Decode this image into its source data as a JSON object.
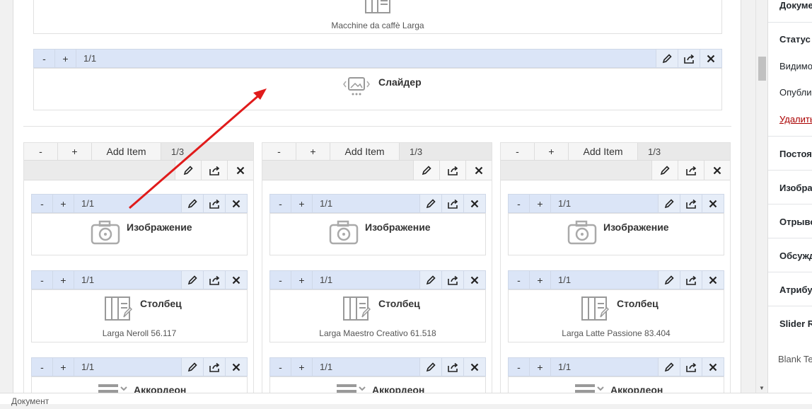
{
  "top_element": {
    "subtitle": "Macchine da caffè Larga"
  },
  "slider_element": {
    "counter": "1/1",
    "title": "Слайдер"
  },
  "columns": [
    {
      "head": {
        "minus": "-",
        "plus": "+",
        "add_item": "Add Item",
        "ratio": "1/3"
      },
      "elements": [
        {
          "counter": "1/1",
          "title": "Изображение",
          "subtitle": ""
        },
        {
          "counter": "1/1",
          "title": "Столбец",
          "subtitle": "Larga Neroll 56.117"
        },
        {
          "counter": "1/1",
          "title": "Аккордеон",
          "subtitle": ""
        }
      ]
    },
    {
      "head": {
        "minus": "-",
        "plus": "+",
        "add_item": "Add Item",
        "ratio": "1/3"
      },
      "elements": [
        {
          "counter": "1/1",
          "title": "Изображение",
          "subtitle": ""
        },
        {
          "counter": "1/1",
          "title": "Столбец",
          "subtitle": "Larga Maestro Creativo 61.518"
        },
        {
          "counter": "1/1",
          "title": "Аккордеон",
          "subtitle": ""
        }
      ]
    },
    {
      "head": {
        "minus": "-",
        "plus": "+",
        "add_item": "Add Item",
        "ratio": "1/3"
      },
      "elements": [
        {
          "counter": "1/1",
          "title": "Изображение",
          "subtitle": ""
        },
        {
          "counter": "1/1",
          "title": "Столбец",
          "subtitle": "Larga Latte Passione 83.404"
        },
        {
          "counter": "1/1",
          "title": "Аккордеон",
          "subtitle": ""
        }
      ]
    }
  ],
  "toolbar": {
    "minus": "-",
    "plus": "+"
  },
  "sidebar": {
    "tab": "Докуме",
    "status": "Статус и",
    "visibility": "Видимо",
    "published": "Опубли",
    "delete": "Удалить",
    "permalink": "Постоян",
    "image": "Изобра",
    "excerpt": "Отрыво",
    "discussion": "Обсужд",
    "attributes": "Атрибут",
    "slider": "Slider Re",
    "blank": "Blank Te"
  },
  "statusbar": {
    "text": "Документ"
  },
  "colors": {
    "toolbar_bg": "#dbe5f7",
    "arrow": "#e01b1b",
    "delete_link": "#a00"
  }
}
